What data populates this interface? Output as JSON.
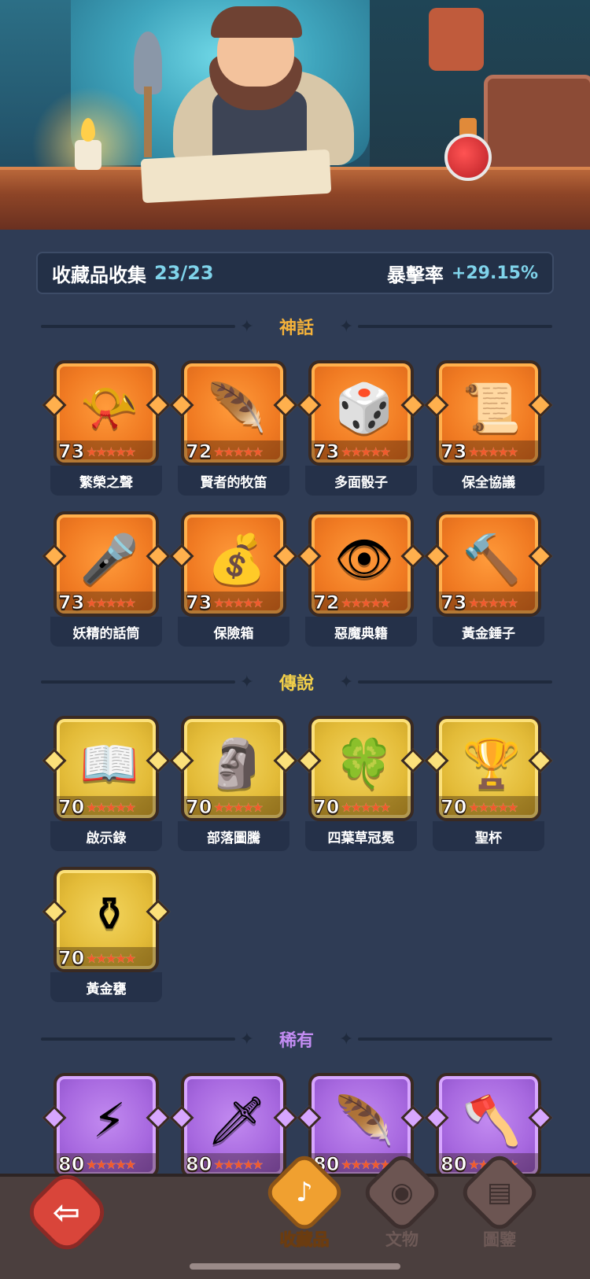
{
  "summary": {
    "title": "收藏品收集",
    "count": "23/23",
    "stat_label": "暴擊率",
    "stat_value": "+29.15%"
  },
  "sections": {
    "mythic": "神話",
    "legendary": "傳說",
    "rare": "稀有"
  },
  "mythic_items": [
    {
      "name": "繁榮之聲",
      "level": "73",
      "icon": "horn-icon",
      "glyph": "📯"
    },
    {
      "name": "賢者的牧笛",
      "level": "72",
      "icon": "flute-icon",
      "glyph": "🪶"
    },
    {
      "name": "多面骰子",
      "level": "73",
      "icon": "dice-icon",
      "glyph": "🎲"
    },
    {
      "name": "保全協議",
      "level": "73",
      "icon": "scroll-icon",
      "glyph": "📜"
    },
    {
      "name": "妖精的話筒",
      "level": "73",
      "icon": "fairy-microphone-icon",
      "glyph": "🎤"
    },
    {
      "name": "保險箱",
      "level": "73",
      "icon": "treasure-chest-icon",
      "glyph": "💰"
    },
    {
      "name": "惡魔典籍",
      "level": "72",
      "icon": "demon-tome-icon",
      "glyph": "👁"
    },
    {
      "name": "黃金錘子",
      "level": "73",
      "icon": "hammer-icon",
      "glyph": "🔨"
    }
  ],
  "legendary_items": [
    {
      "name": "啟示錄",
      "level": "70",
      "icon": "book-icon",
      "glyph": "📖"
    },
    {
      "name": "部落圖騰",
      "level": "70",
      "icon": "totem-icon",
      "glyph": "🗿"
    },
    {
      "name": "四葉草冠冕",
      "level": "70",
      "icon": "clover-crown-icon",
      "glyph": "🍀"
    },
    {
      "name": "聖杯",
      "level": "70",
      "icon": "chalice-icon",
      "glyph": "🏆"
    },
    {
      "name": "黃金甕",
      "level": "70",
      "icon": "golden-urn-icon",
      "glyph": "⚱"
    }
  ],
  "rare_items": [
    {
      "level": "80",
      "icon": "lightning-crystal-icon",
      "glyph": "⚡"
    },
    {
      "level": "80",
      "icon": "ice-dagger-icon",
      "glyph": "🗡"
    },
    {
      "level": "80",
      "icon": "phoenix-feather-icon",
      "glyph": "🪶"
    },
    {
      "level": "80",
      "icon": "axe-icon",
      "glyph": "🪓"
    }
  ],
  "nav": {
    "back": "back-arrow-icon",
    "tabs": [
      {
        "label": "收藏品",
        "icon": "lyre-icon",
        "glyph": "♪",
        "active": true
      },
      {
        "label": "文物",
        "icon": "eye-icon",
        "glyph": "◉",
        "active": false
      },
      {
        "label": "圖鑒",
        "icon": "book-icon",
        "glyph": "▤",
        "active": false
      }
    ]
  }
}
